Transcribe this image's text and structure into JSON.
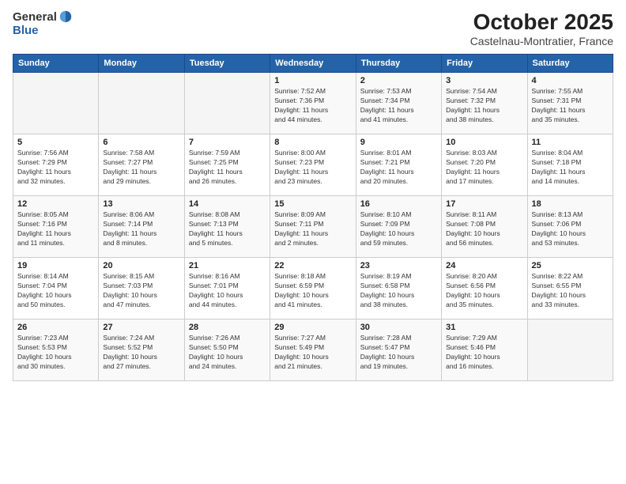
{
  "header": {
    "logo_line1": "General",
    "logo_line2": "Blue",
    "month_title": "October 2025",
    "location": "Castelnau-Montratier, France"
  },
  "days_of_week": [
    "Sunday",
    "Monday",
    "Tuesday",
    "Wednesday",
    "Thursday",
    "Friday",
    "Saturday"
  ],
  "weeks": [
    [
      {
        "day": "",
        "info": ""
      },
      {
        "day": "",
        "info": ""
      },
      {
        "day": "",
        "info": ""
      },
      {
        "day": "1",
        "info": "Sunrise: 7:52 AM\nSunset: 7:36 PM\nDaylight: 11 hours\nand 44 minutes."
      },
      {
        "day": "2",
        "info": "Sunrise: 7:53 AM\nSunset: 7:34 PM\nDaylight: 11 hours\nand 41 minutes."
      },
      {
        "day": "3",
        "info": "Sunrise: 7:54 AM\nSunset: 7:32 PM\nDaylight: 11 hours\nand 38 minutes."
      },
      {
        "day": "4",
        "info": "Sunrise: 7:55 AM\nSunset: 7:31 PM\nDaylight: 11 hours\nand 35 minutes."
      }
    ],
    [
      {
        "day": "5",
        "info": "Sunrise: 7:56 AM\nSunset: 7:29 PM\nDaylight: 11 hours\nand 32 minutes."
      },
      {
        "day": "6",
        "info": "Sunrise: 7:58 AM\nSunset: 7:27 PM\nDaylight: 11 hours\nand 29 minutes."
      },
      {
        "day": "7",
        "info": "Sunrise: 7:59 AM\nSunset: 7:25 PM\nDaylight: 11 hours\nand 26 minutes."
      },
      {
        "day": "8",
        "info": "Sunrise: 8:00 AM\nSunset: 7:23 PM\nDaylight: 11 hours\nand 23 minutes."
      },
      {
        "day": "9",
        "info": "Sunrise: 8:01 AM\nSunset: 7:21 PM\nDaylight: 11 hours\nand 20 minutes."
      },
      {
        "day": "10",
        "info": "Sunrise: 8:03 AM\nSunset: 7:20 PM\nDaylight: 11 hours\nand 17 minutes."
      },
      {
        "day": "11",
        "info": "Sunrise: 8:04 AM\nSunset: 7:18 PM\nDaylight: 11 hours\nand 14 minutes."
      }
    ],
    [
      {
        "day": "12",
        "info": "Sunrise: 8:05 AM\nSunset: 7:16 PM\nDaylight: 11 hours\nand 11 minutes."
      },
      {
        "day": "13",
        "info": "Sunrise: 8:06 AM\nSunset: 7:14 PM\nDaylight: 11 hours\nand 8 minutes."
      },
      {
        "day": "14",
        "info": "Sunrise: 8:08 AM\nSunset: 7:13 PM\nDaylight: 11 hours\nand 5 minutes."
      },
      {
        "day": "15",
        "info": "Sunrise: 8:09 AM\nSunset: 7:11 PM\nDaylight: 11 hours\nand 2 minutes."
      },
      {
        "day": "16",
        "info": "Sunrise: 8:10 AM\nSunset: 7:09 PM\nDaylight: 10 hours\nand 59 minutes."
      },
      {
        "day": "17",
        "info": "Sunrise: 8:11 AM\nSunset: 7:08 PM\nDaylight: 10 hours\nand 56 minutes."
      },
      {
        "day": "18",
        "info": "Sunrise: 8:13 AM\nSunset: 7:06 PM\nDaylight: 10 hours\nand 53 minutes."
      }
    ],
    [
      {
        "day": "19",
        "info": "Sunrise: 8:14 AM\nSunset: 7:04 PM\nDaylight: 10 hours\nand 50 minutes."
      },
      {
        "day": "20",
        "info": "Sunrise: 8:15 AM\nSunset: 7:03 PM\nDaylight: 10 hours\nand 47 minutes."
      },
      {
        "day": "21",
        "info": "Sunrise: 8:16 AM\nSunset: 7:01 PM\nDaylight: 10 hours\nand 44 minutes."
      },
      {
        "day": "22",
        "info": "Sunrise: 8:18 AM\nSunset: 6:59 PM\nDaylight: 10 hours\nand 41 minutes."
      },
      {
        "day": "23",
        "info": "Sunrise: 8:19 AM\nSunset: 6:58 PM\nDaylight: 10 hours\nand 38 minutes."
      },
      {
        "day": "24",
        "info": "Sunrise: 8:20 AM\nSunset: 6:56 PM\nDaylight: 10 hours\nand 35 minutes."
      },
      {
        "day": "25",
        "info": "Sunrise: 8:22 AM\nSunset: 6:55 PM\nDaylight: 10 hours\nand 33 minutes."
      }
    ],
    [
      {
        "day": "26",
        "info": "Sunrise: 7:23 AM\nSunset: 5:53 PM\nDaylight: 10 hours\nand 30 minutes."
      },
      {
        "day": "27",
        "info": "Sunrise: 7:24 AM\nSunset: 5:52 PM\nDaylight: 10 hours\nand 27 minutes."
      },
      {
        "day": "28",
        "info": "Sunrise: 7:26 AM\nSunset: 5:50 PM\nDaylight: 10 hours\nand 24 minutes."
      },
      {
        "day": "29",
        "info": "Sunrise: 7:27 AM\nSunset: 5:49 PM\nDaylight: 10 hours\nand 21 minutes."
      },
      {
        "day": "30",
        "info": "Sunrise: 7:28 AM\nSunset: 5:47 PM\nDaylight: 10 hours\nand 19 minutes."
      },
      {
        "day": "31",
        "info": "Sunrise: 7:29 AM\nSunset: 5:46 PM\nDaylight: 10 hours\nand 16 minutes."
      },
      {
        "day": "",
        "info": ""
      }
    ]
  ]
}
